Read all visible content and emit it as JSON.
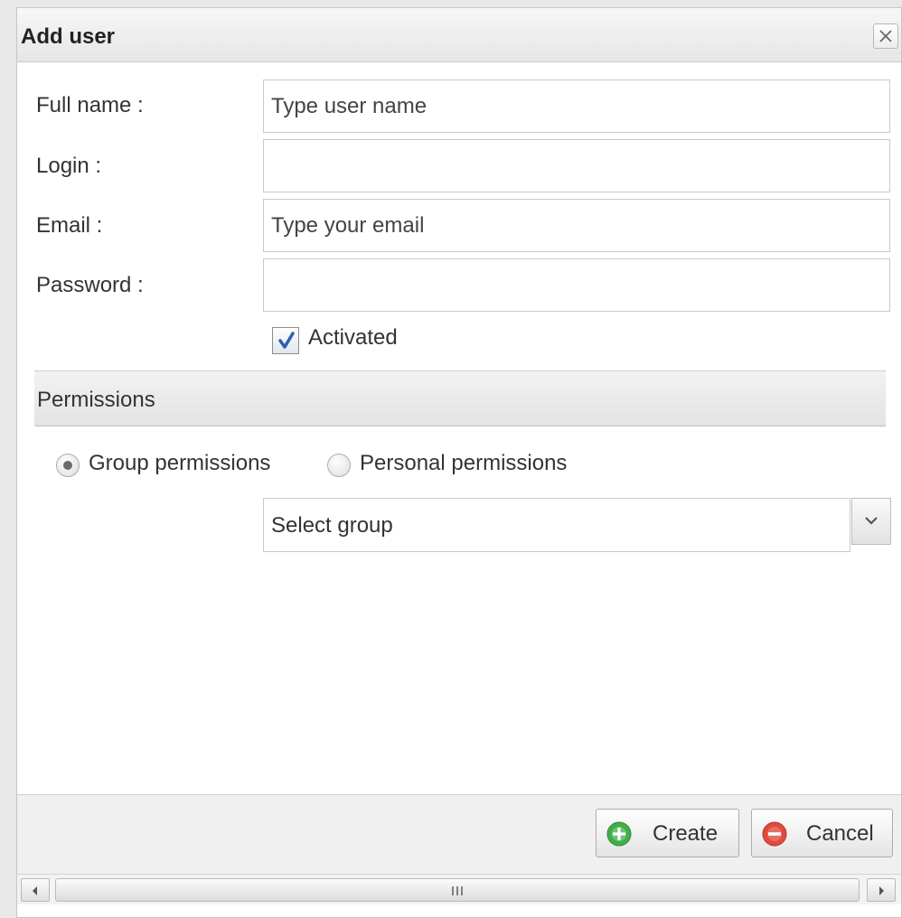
{
  "dialog": {
    "title": "Add user",
    "close_icon": "close-icon"
  },
  "form": {
    "full_name": {
      "label": "Full name :",
      "value": "",
      "placeholder": "Type user name"
    },
    "login": {
      "label": "Login :",
      "value": "",
      "placeholder": ""
    },
    "email": {
      "label": "Email :",
      "value": "",
      "placeholder": "Type your email"
    },
    "password": {
      "label": "Password :",
      "value": "",
      "placeholder": ""
    },
    "activated": {
      "label": "Activated",
      "checked": true
    }
  },
  "permissions": {
    "section_title": "Permissions",
    "options": [
      {
        "label": "Group permissions",
        "selected": true
      },
      {
        "label": "Personal permissions",
        "selected": false
      }
    ],
    "group_select": {
      "value": "Select group"
    }
  },
  "footer": {
    "create_label": "Create",
    "cancel_label": "Cancel",
    "create_icon": "plus-circle-icon",
    "cancel_icon": "minus-circle-icon"
  },
  "colors": {
    "create_icon": "#3fae49",
    "cancel_icon": "#e04a3f",
    "checkmark": "#2f5fb0"
  }
}
